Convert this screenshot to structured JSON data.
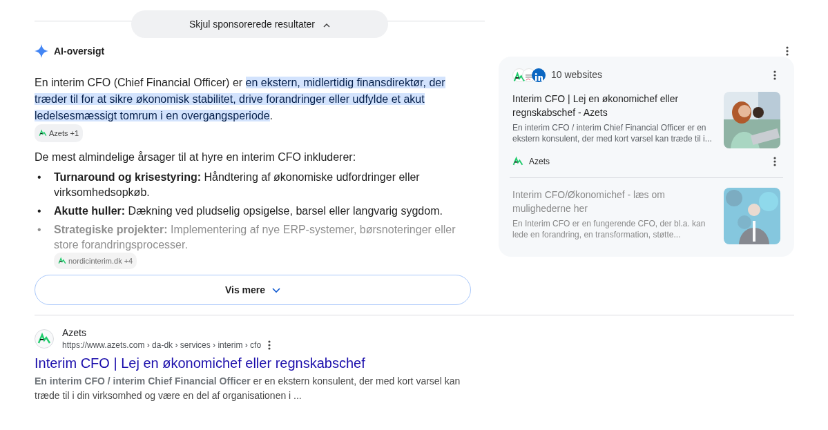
{
  "sponsored_toggle": {
    "label": "Skjul sponsorerede resultater",
    "expanded": true
  },
  "ai_overview": {
    "title": "AI-oversigt",
    "intro": {
      "text": "En interim CFO (Chief Financial Officer) er ",
      "highlight": "en ekstern, midlertidig finansdirektør, der træder til for at sikre økonomisk stabilitet, drive forandringer eller udfylde et akut ledelsesmæssigt tomrum i en overgangsperiode",
      "end": ".",
      "chip": "Azets +1"
    },
    "lead": "De mest almindelige årsager til at hyre en interim CFO inkluderer:",
    "bullets": [
      {
        "marker": "•",
        "text": "**Turnaround og krisestyring:** Håndtering af økonomiske udfordringer eller virksomhedsopkøb.",
        "faded": false
      },
      {
        "marker": "•",
        "text": "**Akutte huller:** Dækning ved pludselig opsigelse, barsel eller langvarig sygdom.",
        "faded": false
      },
      {
        "marker": "•",
        "text": "**Strategiske projekter:** Implementering af nye ERP-systemer, børsnoteringer eller store forandringsprocesser.",
        "faded": true,
        "chip": "nordicinterim.dk +4"
      }
    ],
    "more_button": "Vis mere",
    "sources": {
      "count": "10 websites",
      "items": [
        {
          "title": "Interim CFO | Lej en økonomichef eller regnskabschef - Azets",
          "snippet": "En interim CFO / interim Chief Financial Officer er en ekstern konsulent, der med kort varsel kan træde til i...",
          "site": "Azets",
          "faded": false
        },
        {
          "title": "Interim CFO/Økonomichef - læs om mulighederne her",
          "snippet": "En Interim CFO er en fungerende CFO, der bl.a. kan lede en forandring, en transformation, støtte...",
          "faded": true
        }
      ]
    }
  },
  "result": {
    "site": "Azets",
    "url": "https://www.azets.com › da-dk › services › interim › cfo",
    "title": "Interim CFO | Lej en økonomichef eller regnskabschef",
    "snippet": "**En interim CFO / interim Chief Financial Officer** er en ekstern konsulent, der med kort varsel kan træde til i din virksomhed og være en del af organisationen i ..."
  }
}
